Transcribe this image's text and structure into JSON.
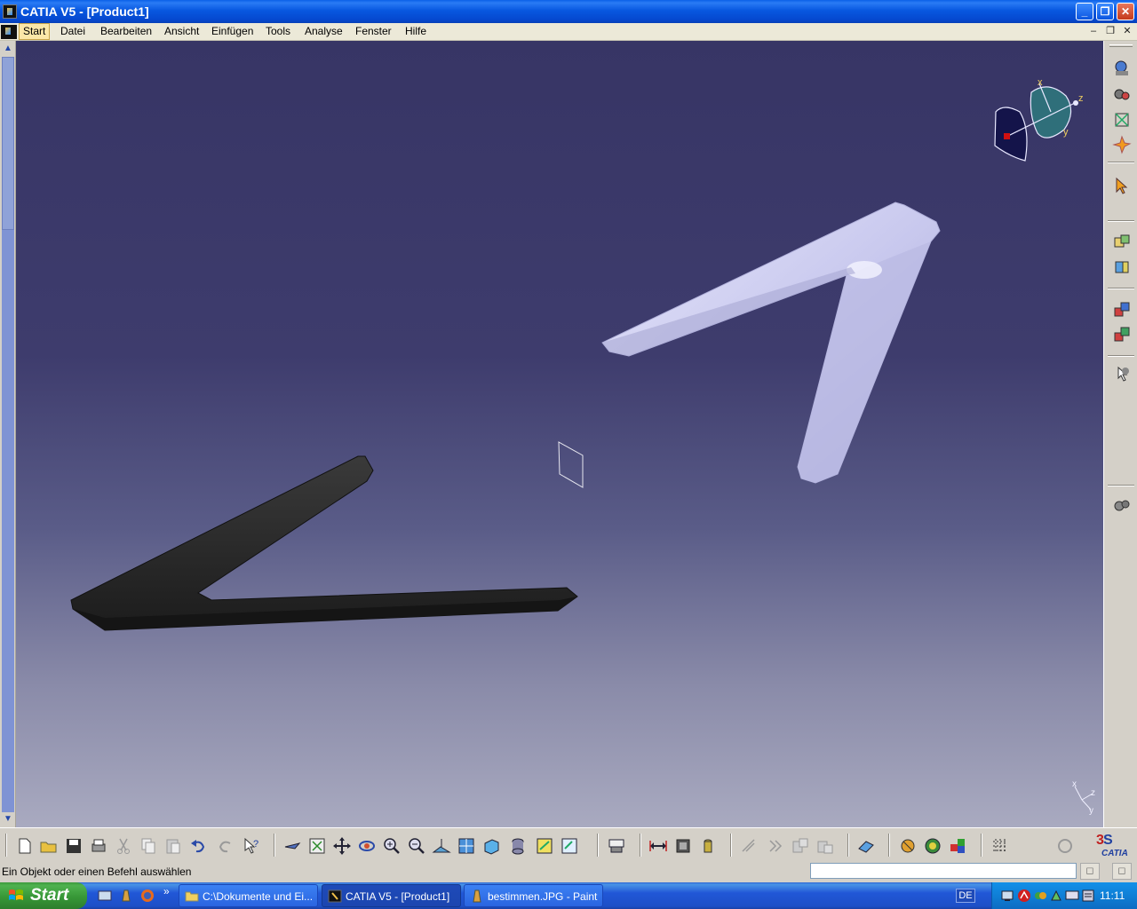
{
  "window": {
    "title": "CATIA V5 - [Product1]",
    "minimize_glyph": "_",
    "restore_glyph": "❐",
    "close_glyph": "✕"
  },
  "menu": {
    "items": [
      "Start",
      "Datei",
      "Bearbeiten",
      "Ansicht",
      "Einfügen",
      "Tools",
      "Analyse",
      "Fenster",
      "Hilfe"
    ],
    "mdi_min": "–",
    "mdi_restore": "❐",
    "mdi_close": "✕"
  },
  "compass": {
    "x_label": "x",
    "y_label": "y",
    "z_label": "z"
  },
  "axis_triad": {
    "x_label": "x",
    "y_label": "y",
    "z_label": "z"
  },
  "statusbar": {
    "message": "Ein Objekt oder einen Befehl auswählen",
    "command_value": ""
  },
  "taskbar": {
    "start_label": "Start",
    "chevron": "»",
    "tasks": [
      {
        "label": "C:\\Dokumente und Ei...",
        "icon": "folder-icon"
      },
      {
        "label": "CATIA V5 - [Product1]",
        "icon": "catia-icon"
      },
      {
        "label": "bestimmen.JPG - Paint",
        "icon": "paint-icon"
      }
    ],
    "language": "DE",
    "clock": "11:11"
  },
  "colors": {
    "viewport_top": "#373565",
    "viewport_bottom": "#a9aac0",
    "part_light": "#d8d8f4",
    "part_dark": "#2a2a2a"
  },
  "icons": {
    "right_toolbar": [
      "fly-mode-icon",
      "walk-icon",
      "fit-icon",
      "spark-icon",
      "select-arrow-icon",
      "product-icon",
      "part-icon",
      "assembly-constraints-icon",
      "update-icon",
      "manipulate-icon",
      "gear-icon"
    ],
    "bottom_toolbar": [
      "new-icon",
      "open-icon",
      "save-icon",
      "print-icon",
      "cut-icon",
      "copy-icon",
      "paste-icon",
      "undo-icon",
      "redo-icon",
      "whats-this-icon",
      "fly-icon",
      "fit-all-icon",
      "pan-icon",
      "rotate-icon",
      "zoom-in-icon",
      "zoom-out-icon",
      "normal-view-icon",
      "multi-view-icon",
      "iso-view-icon",
      "shading-icon",
      "hide-show-icon",
      "swap-icon",
      "measure-icon",
      "clash-icon",
      "catalog-icon",
      "section-icon",
      "explode-icon",
      "snap-icon",
      "constraint-icon",
      "constraint-alt-icon",
      "material-icon",
      "apply-material-icon",
      "render-icon",
      "sketch-icon",
      "grid-icon",
      "catia-logo-icon"
    ]
  }
}
